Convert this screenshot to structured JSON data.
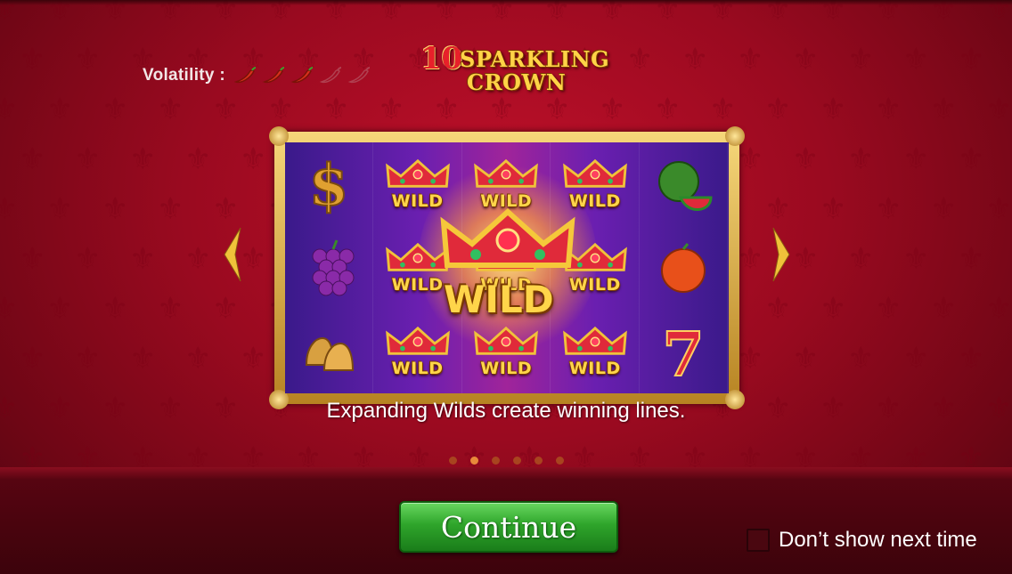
{
  "volatility": {
    "label": "Volatility :",
    "level": 3,
    "max": 5
  },
  "logo": {
    "number": "10",
    "line1": "SPARKLING",
    "line2": "CROWN"
  },
  "reels": {
    "wild_label": "WILD",
    "symbols": [
      [
        "dollar",
        "grapes",
        "bells"
      ],
      [
        "wild",
        "wild",
        "wild"
      ],
      [
        "wild",
        "wild",
        "wild"
      ],
      [
        "wild",
        "wild",
        "wild"
      ],
      [
        "watermelon",
        "orange",
        "seven"
      ]
    ],
    "big_wild_label": "WILD"
  },
  "caption": "Expanding Wilds create winning lines.",
  "pagination": {
    "count": 6,
    "active_index": 1
  },
  "continue_label": "Continue",
  "dont_show_label": "Don’t show next time",
  "colors": {
    "background": "#9a0a20",
    "frame_gold": "#e8b84a",
    "button_green": "#2fa52b",
    "wild_text": "#ffd54a"
  }
}
